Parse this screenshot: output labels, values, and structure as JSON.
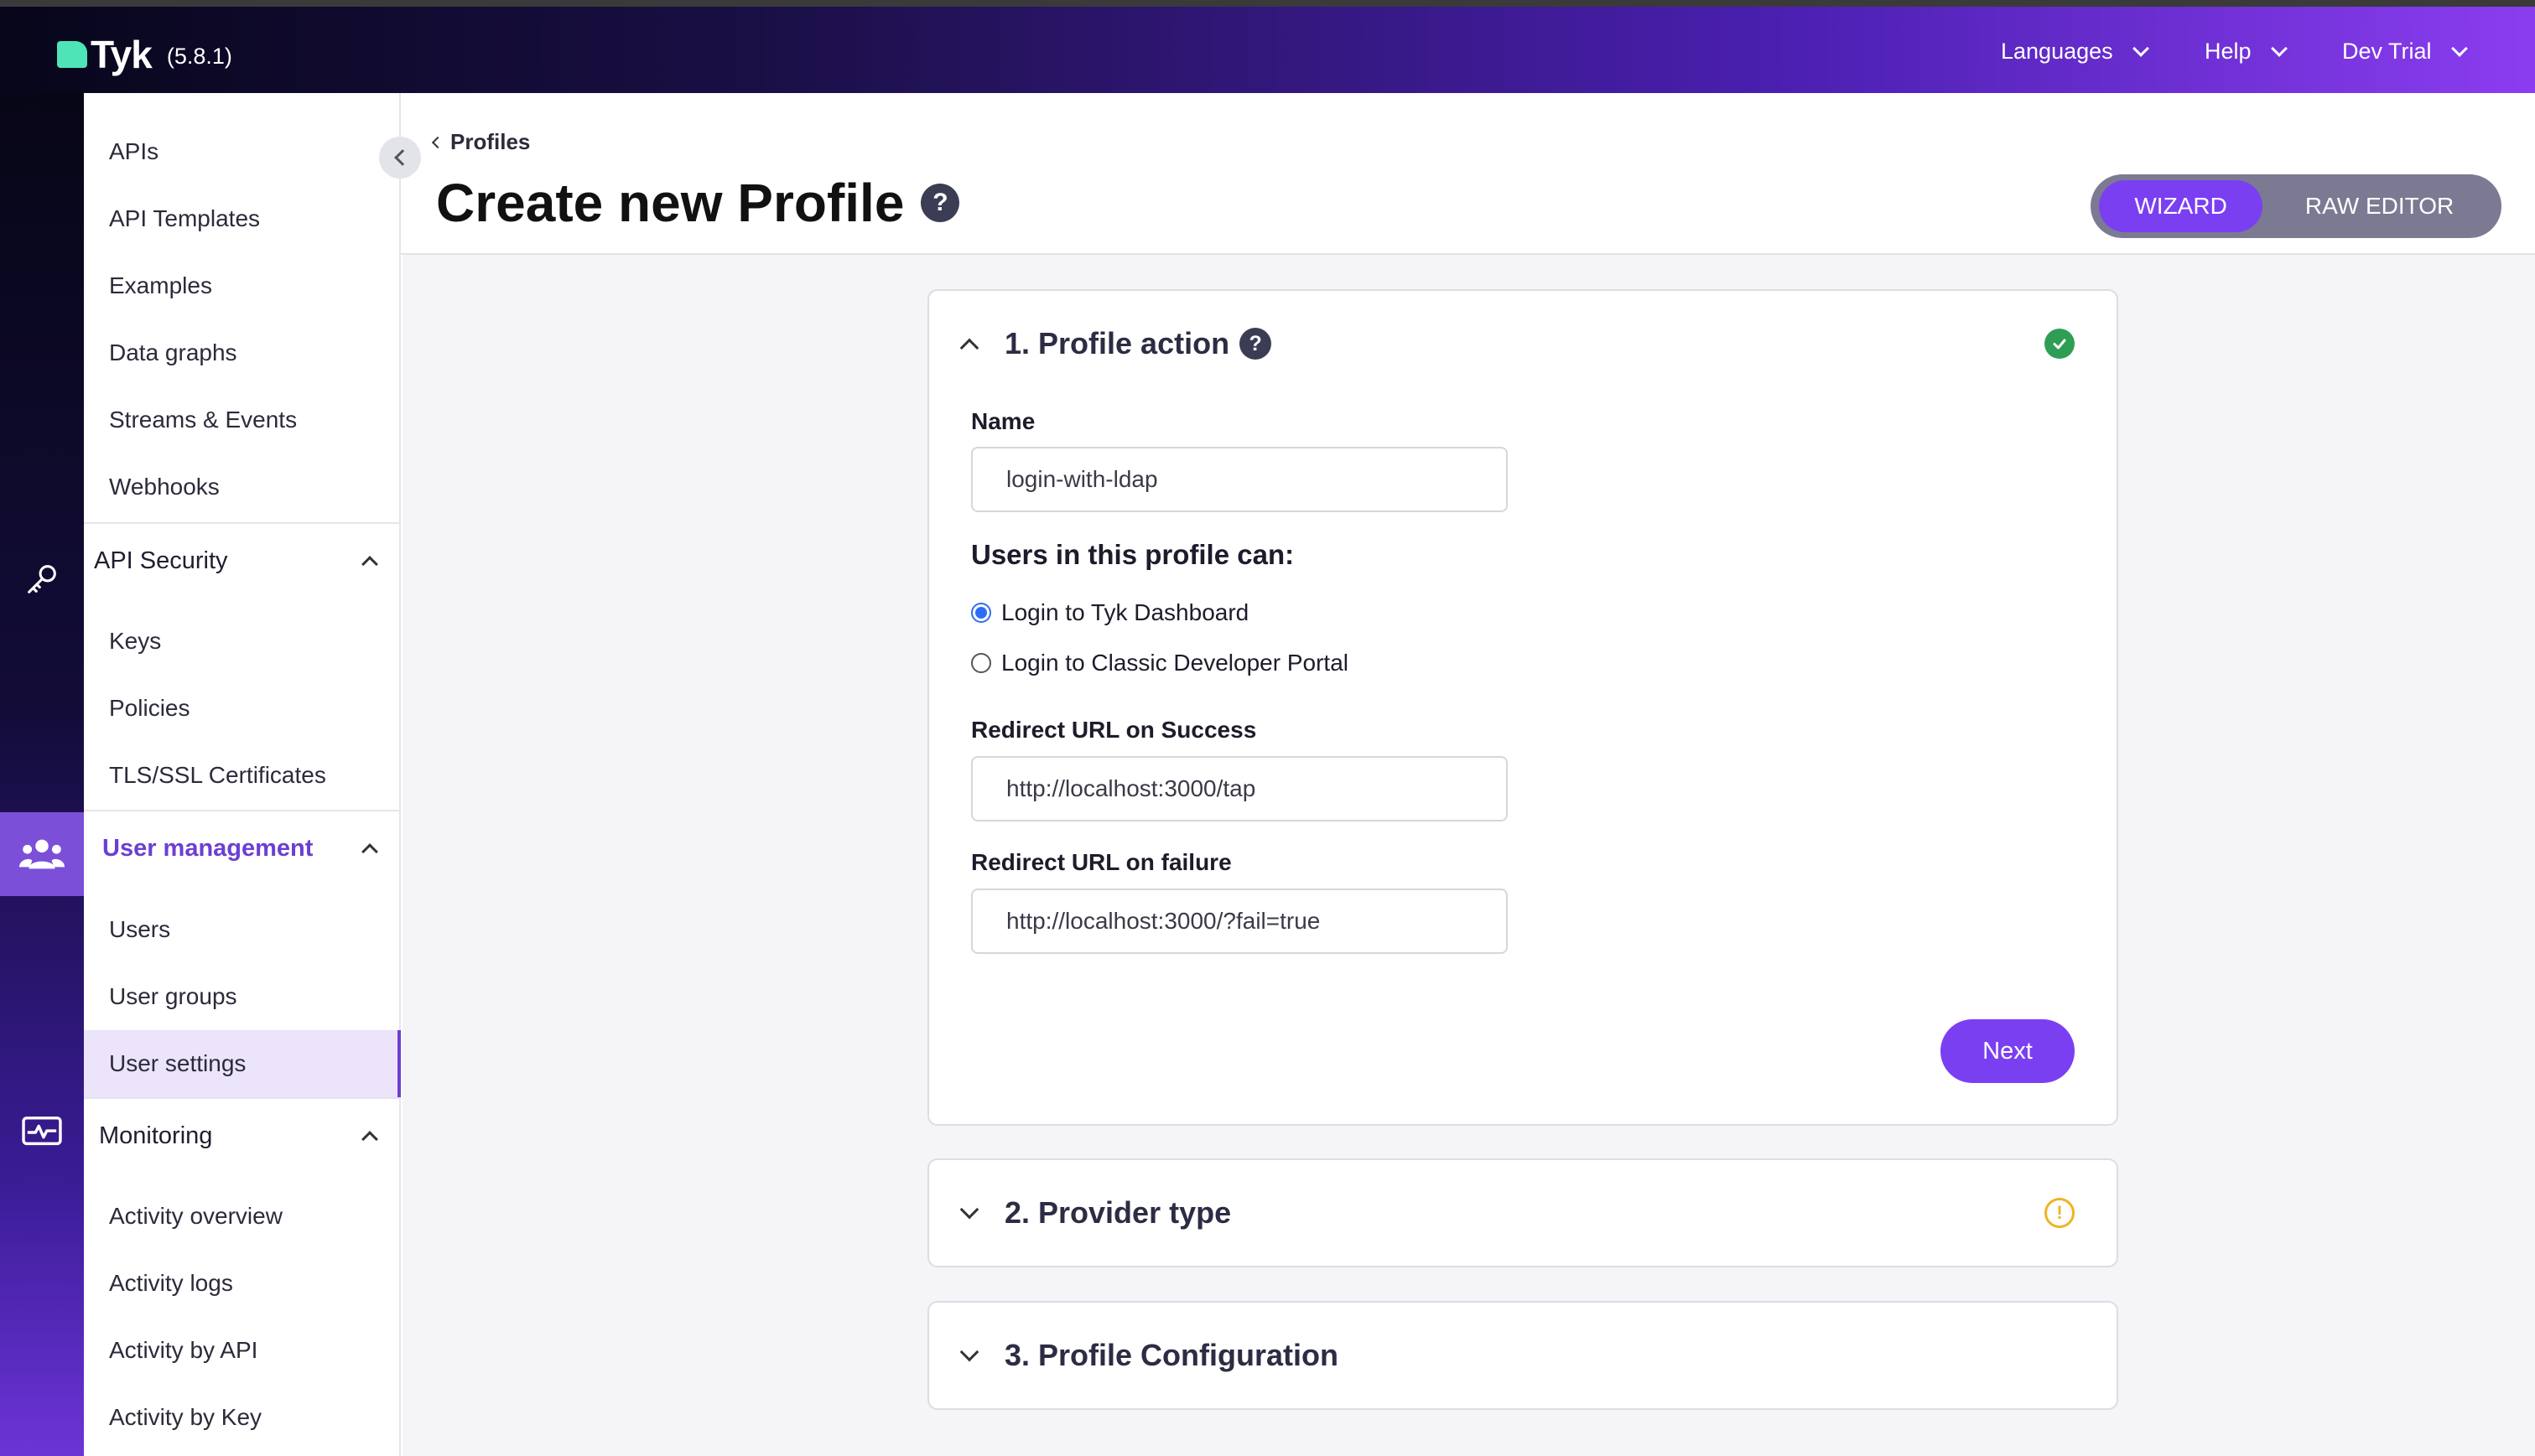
{
  "topbar": {
    "logo_text": "Tyk",
    "version": "(5.8.1)",
    "nav": [
      {
        "label": "Languages"
      },
      {
        "label": "Help"
      },
      {
        "label": "Dev Trial"
      }
    ]
  },
  "sidebar": {
    "top_items": [
      {
        "label": "APIs"
      },
      {
        "label": "API Templates"
      },
      {
        "label": "Examples"
      },
      {
        "label": "Data graphs"
      },
      {
        "label": "Streams & Events"
      },
      {
        "label": "Webhooks"
      }
    ],
    "sections": [
      {
        "label": "API Security",
        "items": [
          {
            "label": "Keys"
          },
          {
            "label": "Policies"
          },
          {
            "label": "TLS/SSL Certificates"
          }
        ]
      },
      {
        "label": "User management",
        "items": [
          {
            "label": "Users"
          },
          {
            "label": "User groups"
          },
          {
            "label": "User settings"
          }
        ]
      },
      {
        "label": "Monitoring",
        "items": [
          {
            "label": "Activity overview"
          },
          {
            "label": "Activity logs"
          },
          {
            "label": "Activity by API"
          },
          {
            "label": "Activity by Key"
          }
        ]
      }
    ],
    "selected_item": "User settings"
  },
  "header": {
    "breadcrumb": "Profiles",
    "title": "Create new Profile",
    "help_glyph": "?",
    "modes": {
      "wizard": "WIZARD",
      "raw": "RAW EDITOR"
    },
    "active_mode": "WIZARD"
  },
  "step1": {
    "title": "1. Profile action",
    "status": "complete",
    "name_label": "Name",
    "name_value": "login-with-ldap",
    "users_heading": "Users in this profile can:",
    "options": [
      {
        "label": "Login to Tyk Dashboard",
        "checked": true
      },
      {
        "label": "Login to Classic Developer Portal",
        "checked": false
      }
    ],
    "success_label": "Redirect URL on Success",
    "success_value": "http://localhost:3000/tap",
    "failure_label": "Redirect URL on failure",
    "failure_value": "http://localhost:3000/?fail=true",
    "next_label": "Next"
  },
  "step2": {
    "title": "2. Provider type",
    "status": "warning",
    "warn_glyph": "!"
  },
  "step3": {
    "title": "3. Profile Configuration"
  },
  "colors": {
    "accent": "#7b3ff2",
    "success": "#2f9e55",
    "warning": "#f0b323",
    "radio": "#2d6df6"
  },
  "icons": {
    "rail": [
      "key-icon",
      "users-icon",
      "monitor-pulse-icon"
    ]
  }
}
